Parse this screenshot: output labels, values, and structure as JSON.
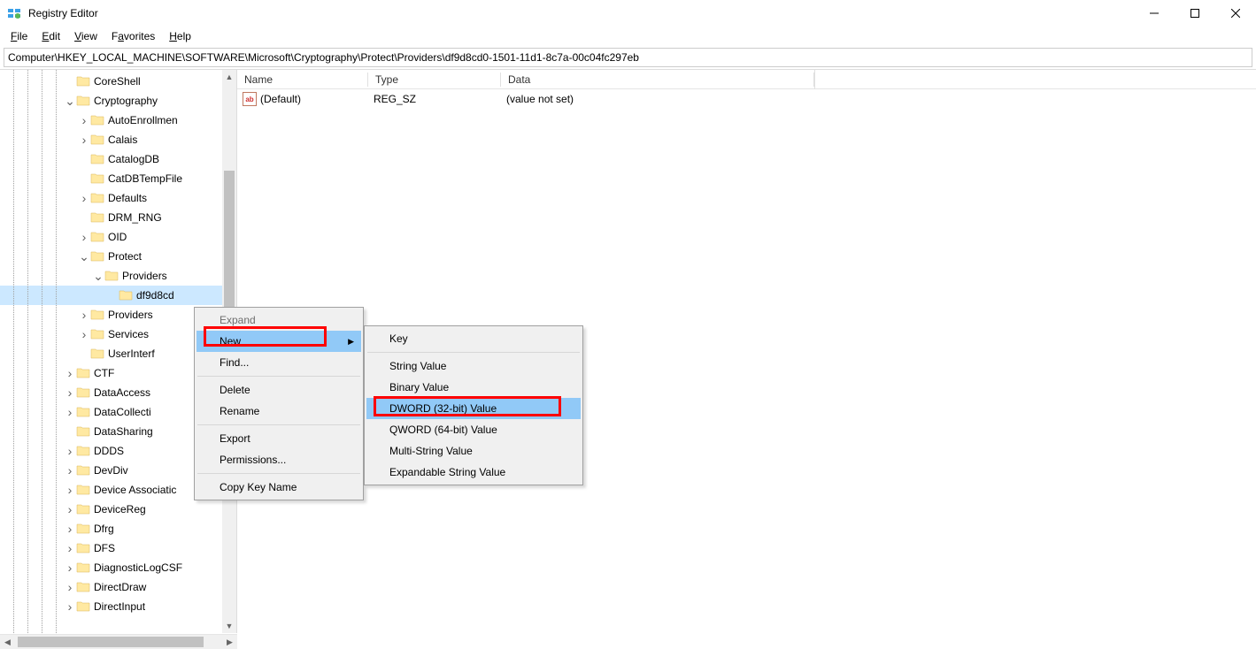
{
  "app_title": "Registry Editor",
  "menu": {
    "file": "File",
    "edit": "Edit",
    "view": "View",
    "favorites": "Favorites",
    "help": "Help"
  },
  "address": "Computer\\HKEY_LOCAL_MACHINE\\SOFTWARE\\Microsoft\\Cryptography\\Protect\\Providers\\df9d8cd0-1501-11d1-8c7a-00c04fc297eb",
  "columns": {
    "name": "Name",
    "type": "Type",
    "data": "Data"
  },
  "values": [
    {
      "name": "(Default)",
      "type": "REG_SZ",
      "data": "(value not set)"
    }
  ],
  "tree": {
    "items": [
      {
        "indent": 4,
        "twisty": "",
        "label": "CoreShell"
      },
      {
        "indent": 4,
        "twisty": "v",
        "label": "Cryptography"
      },
      {
        "indent": 5,
        "twisty": ">",
        "label": "AutoEnrollmen"
      },
      {
        "indent": 5,
        "twisty": ">",
        "label": "Calais"
      },
      {
        "indent": 5,
        "twisty": "",
        "label": "CatalogDB"
      },
      {
        "indent": 5,
        "twisty": "",
        "label": "CatDBTempFile"
      },
      {
        "indent": 5,
        "twisty": ">",
        "label": "Defaults"
      },
      {
        "indent": 5,
        "twisty": "",
        "label": "DRM_RNG"
      },
      {
        "indent": 5,
        "twisty": ">",
        "label": "OID"
      },
      {
        "indent": 5,
        "twisty": "v",
        "label": "Protect"
      },
      {
        "indent": 6,
        "twisty": "v",
        "label": "Providers"
      },
      {
        "indent": 7,
        "twisty": "",
        "label": "df9d8cd",
        "selected": true
      },
      {
        "indent": 5,
        "twisty": ">",
        "label": "Providers"
      },
      {
        "indent": 5,
        "twisty": ">",
        "label": "Services"
      },
      {
        "indent": 5,
        "twisty": "",
        "label": "UserInterf"
      },
      {
        "indent": 4,
        "twisty": ">",
        "label": "CTF"
      },
      {
        "indent": 4,
        "twisty": ">",
        "label": "DataAccess"
      },
      {
        "indent": 4,
        "twisty": ">",
        "label": "DataCollecti"
      },
      {
        "indent": 4,
        "twisty": "",
        "label": "DataSharing"
      },
      {
        "indent": 4,
        "twisty": ">",
        "label": "DDDS"
      },
      {
        "indent": 4,
        "twisty": ">",
        "label": "DevDiv"
      },
      {
        "indent": 4,
        "twisty": ">",
        "label": "Device Associatic"
      },
      {
        "indent": 4,
        "twisty": ">",
        "label": "DeviceReg"
      },
      {
        "indent": 4,
        "twisty": ">",
        "label": "Dfrg"
      },
      {
        "indent": 4,
        "twisty": ">",
        "label": "DFS"
      },
      {
        "indent": 4,
        "twisty": ">",
        "label": "DiagnosticLogCSF"
      },
      {
        "indent": 4,
        "twisty": ">",
        "label": "DirectDraw"
      },
      {
        "indent": 4,
        "twisty": ">",
        "label": "DirectInput"
      }
    ]
  },
  "context_menu": {
    "items": [
      {
        "label": "Expand",
        "kind": "disabled"
      },
      {
        "label": "New",
        "kind": "hover-arrow"
      },
      {
        "label": "Find...",
        "kind": "normal"
      },
      {
        "kind": "sep"
      },
      {
        "label": "Delete",
        "kind": "normal"
      },
      {
        "label": "Rename",
        "kind": "normal"
      },
      {
        "kind": "sep"
      },
      {
        "label": "Export",
        "kind": "normal"
      },
      {
        "label": "Permissions...",
        "kind": "normal"
      },
      {
        "kind": "sep"
      },
      {
        "label": "Copy Key Name",
        "kind": "normal"
      }
    ]
  },
  "submenu": {
    "items": [
      {
        "label": "Key"
      },
      {
        "kind": "sep"
      },
      {
        "label": "String Value"
      },
      {
        "label": "Binary Value"
      },
      {
        "label": "DWORD (32-bit) Value",
        "hover": true
      },
      {
        "label": "QWORD (64-bit) Value"
      },
      {
        "label": "Multi-String Value"
      },
      {
        "label": "Expandable String Value"
      }
    ]
  }
}
